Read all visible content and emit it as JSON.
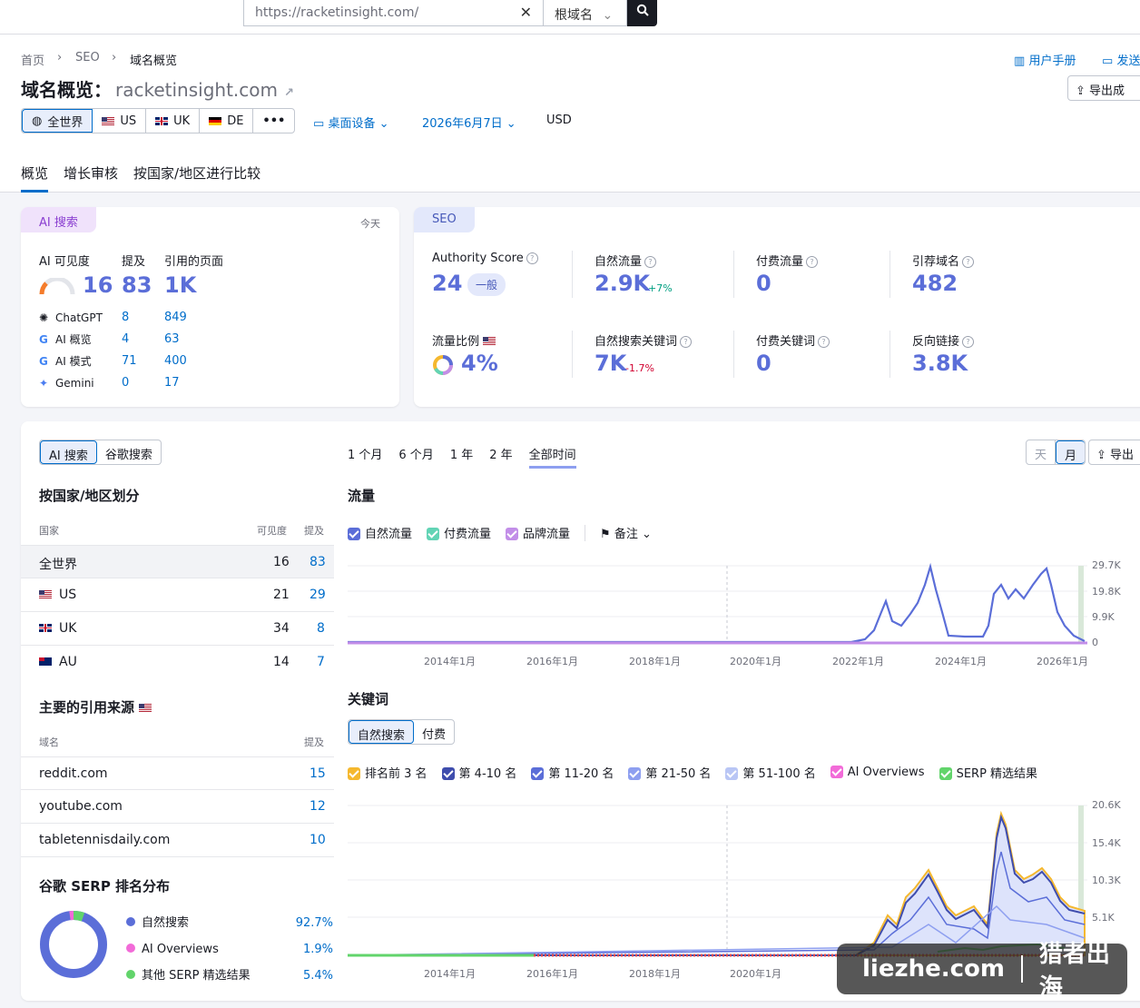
{
  "topbar": {
    "url_value": "https://racketinsight.com/",
    "scope": "根域名"
  },
  "breadcrumb": [
    "首页",
    "SEO",
    "域名概览"
  ],
  "header": {
    "manual": "用户手册",
    "send": "发送",
    "export": "导出成",
    "title_prefix": "域名概览：",
    "domain": "racketinsight.com"
  },
  "geo": {
    "items": [
      "全世界",
      "US",
      "UK",
      "DE"
    ],
    "more": "•••"
  },
  "filters": {
    "device": "桌面设备",
    "date": "2026年6月7日",
    "currency": "USD"
  },
  "tabs": [
    "概览",
    "增长审核",
    "按国家/地区进行比较"
  ],
  "ai": {
    "pill": "AI 搜索",
    "today": "今天",
    "vis_label": "AI 可见度",
    "mention_label": "提及",
    "pages_label": "引用的页面",
    "vis": "16",
    "mentions": "83",
    "pages": "1K",
    "rows": [
      {
        "name": "ChatGPT",
        "a": "8",
        "b": "849"
      },
      {
        "name": "AI 概览",
        "a": "4",
        "b": "63"
      },
      {
        "name": "AI 模式",
        "a": "71",
        "b": "400"
      },
      {
        "name": "Gemini",
        "a": "0",
        "b": "17"
      }
    ]
  },
  "seo": {
    "pill": "SEO",
    "authority_label": "Authority Score",
    "authority": "24",
    "authority_badge": "一般",
    "organic_label": "自然流量",
    "organic": "2.9K",
    "organic_delta": "+7%",
    "paid_label": "付费流量",
    "paid": "0",
    "refdomains_label": "引荐域名",
    "refdomains": "482",
    "share_label": "流量比例",
    "share": "4%",
    "okw_label": "自然搜索关键词",
    "okw": "7K",
    "okw_delta": "-1.7%",
    "pkw_label": "付费关键词",
    "pkw": "0",
    "backlinks_label": "反向链接",
    "backlinks": "3.8K"
  },
  "left": {
    "seg": [
      "AI 搜索",
      "谷歌搜索"
    ],
    "country_title": "按国家/地区划分",
    "col_country": "国家",
    "col_vis": "可见度",
    "col_mention": "提及",
    "countries": [
      {
        "name": "全世界",
        "vis": "16",
        "m": "83"
      },
      {
        "name": "US",
        "vis": "21",
        "m": "29"
      },
      {
        "name": "UK",
        "vis": "34",
        "m": "8"
      },
      {
        "name": "AU",
        "vis": "14",
        "m": "7"
      }
    ],
    "source_title": "主要的引用来源",
    "col_domain": "域名",
    "col_m2": "提及",
    "sources": [
      {
        "d": "reddit.com",
        "m": "15"
      },
      {
        "d": "youtube.com",
        "m": "12"
      },
      {
        "d": "tabletennisdaily.com",
        "m": "10"
      }
    ],
    "serp_title": "谷歌 SERP 排名分布",
    "serp": [
      {
        "name": "自然搜索",
        "v": "92.7%",
        "color": "#5b6ed8"
      },
      {
        "name": "AI Overviews",
        "v": "1.9%",
        "color": "#f26bd8"
      },
      {
        "name": "其他 SERP 精选结果",
        "v": "5.4%",
        "color": "#62d46b"
      }
    ]
  },
  "range": [
    "1 个月",
    "6 个月",
    "1 年",
    "2 年",
    "全部时间"
  ],
  "gran": [
    "天",
    "月"
  ],
  "export2": "导出",
  "traffic": {
    "title": "流量",
    "legend": [
      "自然流量",
      "付费流量",
      "品牌流量"
    ],
    "note": "备注",
    "yticks": [
      "29.7K",
      "19.8K",
      "9.9K",
      "0"
    ],
    "xticks": [
      "2014年1月",
      "2016年1月",
      "2018年1月",
      "2020年1月",
      "2022年1月",
      "2024年1月",
      "2026年1月"
    ]
  },
  "keywords": {
    "title": "关键词",
    "seg": [
      "自然搜索",
      "付费"
    ],
    "legend": [
      "排名前 3 名",
      "第 4-10 名",
      "第 11-20 名",
      "第 21-50 名",
      "第 51-100 名",
      "AI Overviews",
      "SERP 精选结果"
    ],
    "yticks": [
      "20.6K",
      "15.4K",
      "10.3K",
      "5.1K"
    ],
    "xticks": [
      "2014年1月",
      "2016年1月",
      "2018年1月",
      "2020年1月"
    ]
  },
  "colors": {
    "organic": "#5b6ed8",
    "paid": "#62d4b5",
    "brand": "#c28ee8",
    "top3": "#f5b82e",
    "r4": "#3f4dad",
    "r11": "#5b6ed8",
    "r21": "#8e9ff0",
    "r51": "#b9c6f5",
    "aio": "#f26bd8",
    "serp": "#62d46b"
  },
  "watermark": {
    "site": "liezhe.com",
    "name": "猎者出海"
  }
}
